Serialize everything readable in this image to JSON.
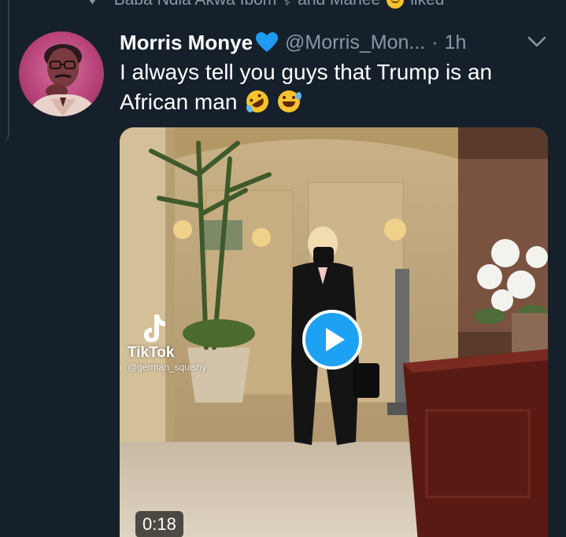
{
  "social_context": {
    "text_before": "Baba Ndia Akwa Ibom",
    "text_after": "and Manee",
    "liked_label": "liked"
  },
  "tweet": {
    "author_name": "Morris Monye",
    "handle": "@Morris_Mon...",
    "separator": "·",
    "time": "1h",
    "text_line1": "I always tell you guys that Trump is an",
    "text_line2": "African man",
    "verified_emoji": "blue-heart"
  },
  "media": {
    "duration": "0:18",
    "watermark_brand": "TikTok",
    "watermark_user": "@german_squishy"
  },
  "icons": {
    "liked": "heart-icon",
    "stethoscope": "stethoscope-emoji",
    "caret": "chevron-down-icon",
    "play": "play-icon"
  },
  "colors": {
    "background": "#15202b",
    "secondary_text": "#8899a6",
    "accent": "#1da1f2",
    "heart_blue": "#1d9bf0"
  }
}
